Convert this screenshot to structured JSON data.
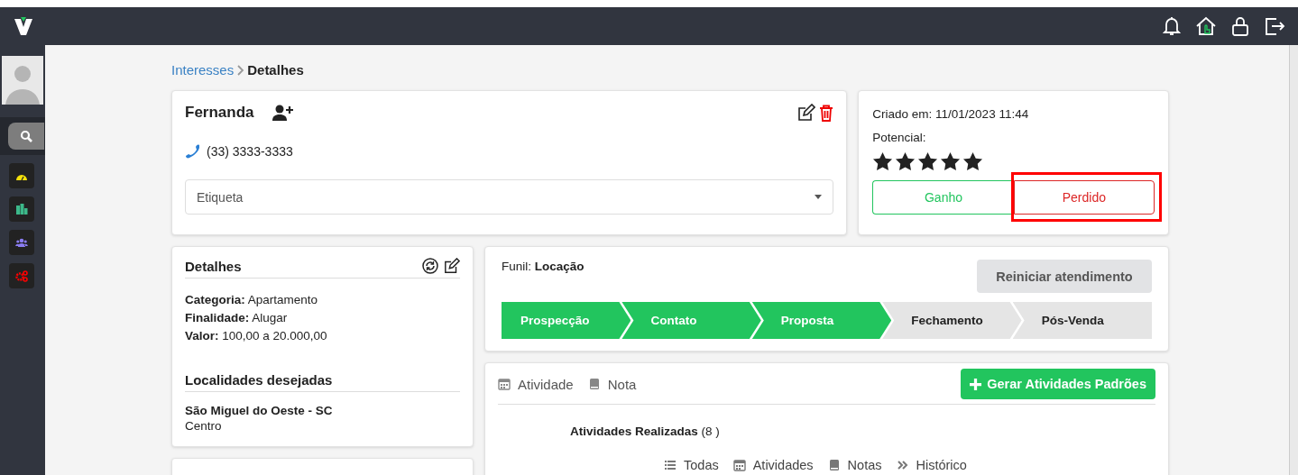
{
  "sidebar": {
    "items": [
      {
        "kind": "search",
        "selected": true
      },
      {
        "kind": "dashboard",
        "selected": false
      },
      {
        "kind": "buildings",
        "selected": false
      },
      {
        "kind": "users",
        "selected": false
      },
      {
        "kind": "settings",
        "selected": false
      }
    ]
  },
  "breadcrumb": {
    "parent": "Interesses",
    "current": "Detalhes"
  },
  "contact": {
    "name": "Fernanda",
    "phone": "(33) 3333-3333",
    "tag_select": {
      "placeholder": "Etiqueta"
    }
  },
  "summary": {
    "created": "Criado em: 11/01/2023 11:44",
    "potential_label": "Potencial:",
    "stars": 5,
    "buttons": [
      {
        "label": "Ganho",
        "kind": "won",
        "highlighted": false
      },
      {
        "label": "Perdido",
        "kind": "lost",
        "highlighted": true
      }
    ]
  },
  "details": {
    "title": "Detalhes",
    "fields": [
      {
        "label": "Categoria:",
        "value": "Apartamento"
      },
      {
        "label": "Finalidade:",
        "value": "Alugar"
      },
      {
        "label": "Valor:",
        "value": "100,00 a 20.000,00"
      }
    ],
    "locations_title": "Localidades desejadas",
    "locations": [
      {
        "city": "São Miguel do Oeste - SC",
        "district": "Centro"
      }
    ]
  },
  "funnel": {
    "label": "Funil:",
    "name": "Locação",
    "restart_button": "Reiniciar atendimento",
    "stages": [
      {
        "label": "Prospecção",
        "completed": true
      },
      {
        "label": "Contato",
        "completed": true
      },
      {
        "label": "Proposta",
        "completed": true
      },
      {
        "label": "Fechamento",
        "completed": false
      },
      {
        "label": "Pós-Venda",
        "completed": false
      }
    ]
  },
  "activity": {
    "tabs": [
      {
        "label": "Atividade",
        "kind": "calendar"
      },
      {
        "label": "Nota",
        "kind": "note"
      }
    ],
    "generate_button": "Gerar Atividades Padrões",
    "summary": "**Atividades Realizadas** (8 )",
    "filters": [
      {
        "label": "Todas",
        "kind": "list"
      },
      {
        "label": "Atividades",
        "kind": "calendar"
      },
      {
        "label": "Notas",
        "kind": "note"
      },
      {
        "label": "Histórico",
        "kind": "history"
      }
    ]
  }
}
